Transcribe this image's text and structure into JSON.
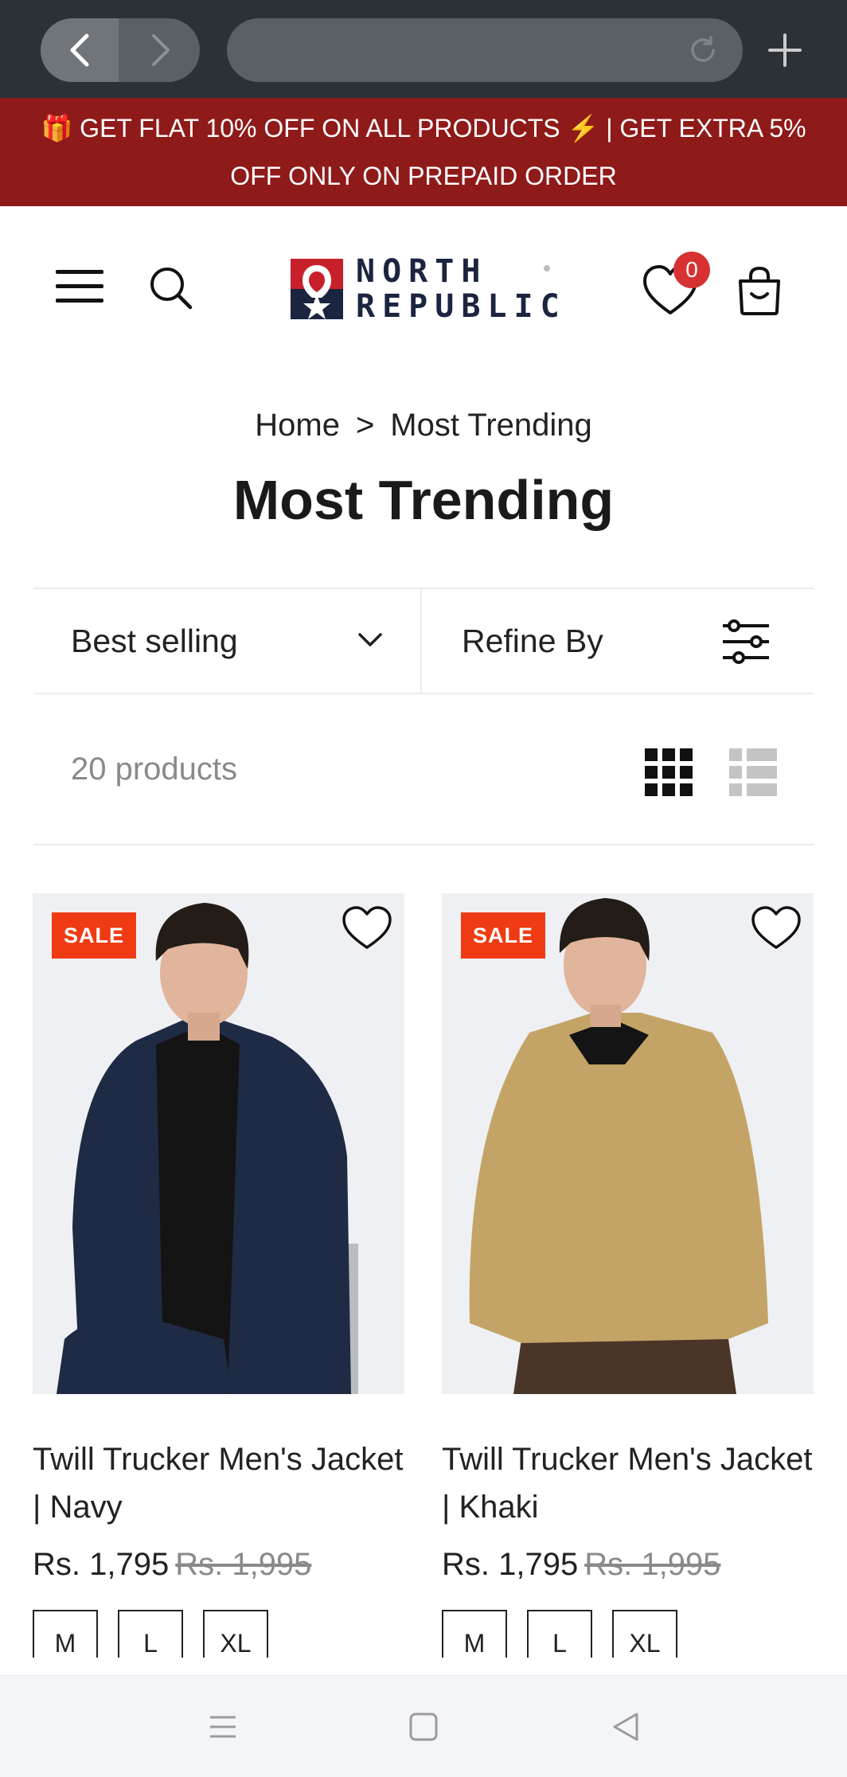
{
  "promo": {
    "line1": "🎁 GET FLAT 10% OFF ON ALL PRODUCTS ⚡ | GET EXTRA 5%",
    "line2": "OFF ONLY ON PREPAID ORDER"
  },
  "header": {
    "logo_line1": "NORTH",
    "logo_line2": "REPUBLIC",
    "wishlist_count": "0"
  },
  "breadcrumb": {
    "home": "Home",
    "separator": ">",
    "current": "Most Trending"
  },
  "page_title": "Most Trending",
  "toolbar": {
    "sort_label": "Best selling",
    "refine_label": "Refine By"
  },
  "product_count": "20 products",
  "products": [
    {
      "badge": "SALE",
      "name": "Twill Trucker Men's Jacket | Navy",
      "price": "Rs. 1,795",
      "compare_price": "Rs. 1,995",
      "sizes": [
        "M",
        "L",
        "XL"
      ],
      "jacket_color": "#1f2a44"
    },
    {
      "badge": "SALE",
      "name": "Twill Trucker Men's Jacket | Khaki",
      "price": "Rs. 1,795",
      "compare_price": "Rs. 1,995",
      "sizes": [
        "M",
        "L",
        "XL"
      ],
      "jacket_color": "#c4a466"
    }
  ],
  "colors": {
    "promo_bg": "#8f1a1a",
    "sale_badge": "#ef3b14",
    "wishlist_badge": "#d73131",
    "logo_navy": "#1b2540"
  }
}
